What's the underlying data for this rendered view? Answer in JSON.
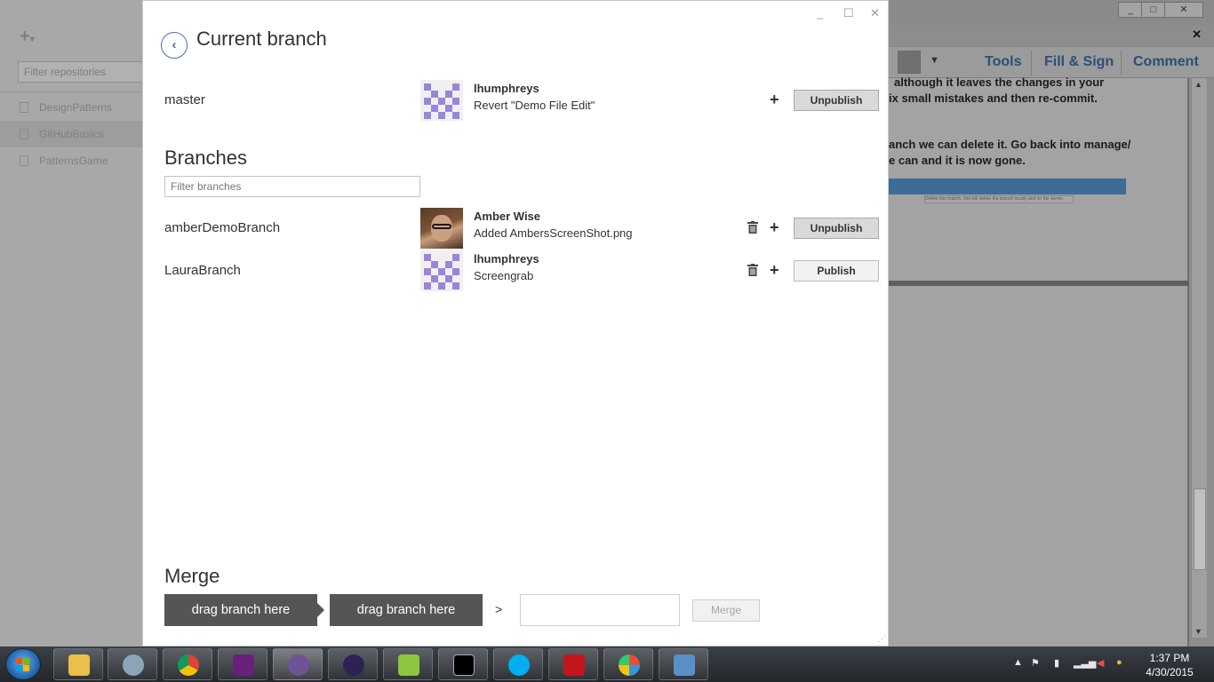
{
  "background_app": {
    "filter_placeholder": "Filter repositories",
    "repositories": [
      "DesignPatterns",
      "GitHubBasics",
      "PatternsGame"
    ],
    "selected_repository": "GitHubBasics"
  },
  "pdf_window": {
    "toolbar": {
      "tools": "Tools",
      "fill_sign": "Fill & Sign",
      "comment": "Comment"
    },
    "text_lines": [
      "although it leaves the changes in your",
      "ix small mistakes and then re-commit.",
      "anch we can delete it. Go back into manage/",
      "e can and it is now gone."
    ],
    "inner_screenshot_caption": "Delete this branch. this will delete the branch locally and on the server."
  },
  "dialog": {
    "title": "Current branch",
    "current_branch": {
      "name": "master",
      "author": "lhumphreys",
      "commit": "Revert \"Demo File Edit\"",
      "button": "Unpublish"
    },
    "branches_title": "Branches",
    "filter_placeholder": "Filter branches",
    "branches": [
      {
        "name": "amberDemoBranch",
        "author": "Amber Wise",
        "commit": "Added AmbersScreenShot.png",
        "button": "Unpublish"
      },
      {
        "name": "LauraBranch",
        "author": "lhumphreys",
        "commit": "Screengrab",
        "button": "Publish"
      }
    ],
    "merge": {
      "title": "Merge",
      "drag_source": "drag branch here",
      "drag_target": "drag branch here",
      "button": "Merge"
    }
  },
  "taskbar": {
    "time": "1:37 PM",
    "date": "4/30/2015",
    "apps": [
      "explorer-icon",
      "network-icon",
      "chrome-icon",
      "visual-studio-icon",
      "github-icon",
      "eclipse-icon",
      "notepad-plus-icon",
      "cmd-icon",
      "skype-icon",
      "acrobat-icon",
      "paint-icon",
      "remote-desktop-icon"
    ]
  }
}
